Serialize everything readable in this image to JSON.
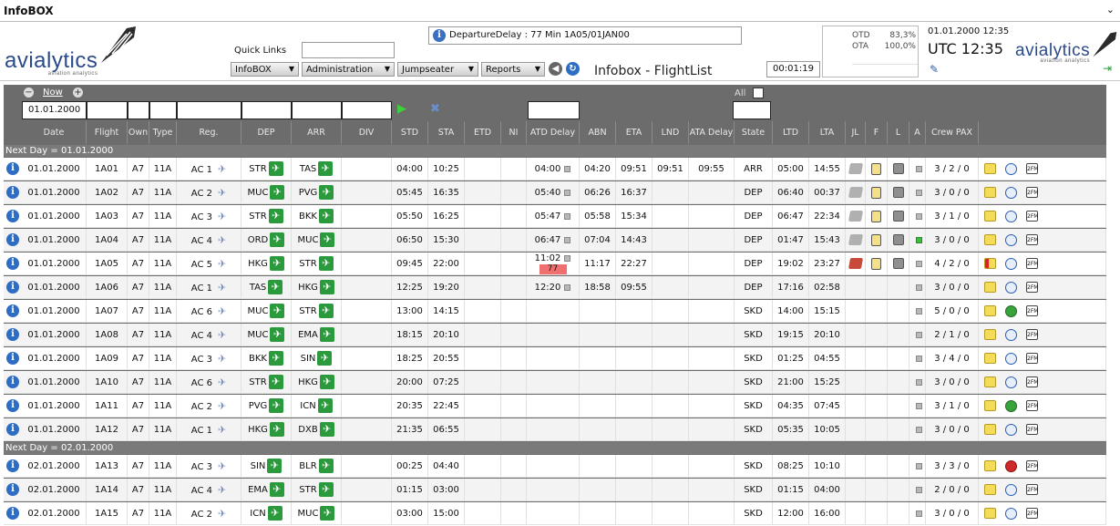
{
  "titlebar": {
    "title": "InfoBOX",
    "chevron": "⌄"
  },
  "header": {
    "logo": "avialytics",
    "logo_sub": "aviation analytics",
    "quick_links_label": "Quick Links",
    "menus": [
      "InfoBOX",
      "Administration",
      "Jumpseater",
      "Reports"
    ],
    "message": "DepartureDelay : 77 Min 1A05/01JAN00",
    "app_title": "Infobox - FlightList",
    "timer": "00:01:19",
    "kpi": [
      {
        "label": "OTD",
        "value": "83,3%"
      },
      {
        "label": "OTA",
        "value": "100,0%"
      }
    ],
    "date_time": "01.01.2000 12:35",
    "utc": "UTC 12:35"
  },
  "controls": {
    "now_label": "Now",
    "date_value": "01.01.2000",
    "all_label": "All"
  },
  "columns": [
    "Date",
    "Flight",
    "Own",
    "Type",
    "Reg.",
    "DEP",
    "ARR",
    "DIV",
    "STD",
    "STA",
    "ETD",
    "NI",
    "ATD Delay",
    "ABN",
    "ETA",
    "LND",
    "ATA Delay",
    "State",
    "LTD",
    "LTA",
    "JL",
    "F",
    "L",
    "A",
    "Crew PAX"
  ],
  "separators": [
    "Next Day = 01.01.2000",
    "Next Day = 02.01.2000"
  ],
  "rows": [
    {
      "date": "01.01.2000",
      "flight": "1A01",
      "own": "A7",
      "type": "11A",
      "reg": "AC 1",
      "dep": "STR",
      "arr": "TAS",
      "std": "04:00",
      "sta": "10:25",
      "atd": "04:00",
      "abn": "04:20",
      "eta": "09:51",
      "lnd": "09:51",
      "ata": "09:55",
      "state": "ARR",
      "ltd": "05:00",
      "lta": "14:55",
      "crew": "3 / 2 / 0",
      "icons": true,
      "a_green": false,
      "book_red": false,
      "clock": "blue"
    },
    {
      "date": "01.01.2000",
      "flight": "1A02",
      "own": "A7",
      "type": "11A",
      "reg": "AC 2",
      "dep": "MUC",
      "arr": "PVG",
      "std": "05:45",
      "sta": "16:35",
      "atd": "05:40",
      "abn": "06:26",
      "eta": "16:37",
      "lnd": "",
      "ata": "",
      "state": "DEP",
      "ltd": "06:40",
      "lta": "00:37",
      "crew": "3 / 0 / 0",
      "icons": true,
      "a_green": false,
      "book_red": false,
      "clock": "blue"
    },
    {
      "date": "01.01.2000",
      "flight": "1A03",
      "own": "A7",
      "type": "11A",
      "reg": "AC 3",
      "dep": "STR",
      "arr": "BKK",
      "std": "05:50",
      "sta": "16:25",
      "atd": "05:47",
      "abn": "05:58",
      "eta": "15:34",
      "lnd": "",
      "ata": "",
      "state": "DEP",
      "ltd": "06:47",
      "lta": "22:34",
      "crew": "3 / 1 / 0",
      "icons": true,
      "a_green": false,
      "book_red": false,
      "clock": "blue"
    },
    {
      "date": "01.01.2000",
      "flight": "1A04",
      "own": "A7",
      "type": "11A",
      "reg": "AC 4",
      "dep": "ORD",
      "arr": "MUC",
      "std": "06:50",
      "sta": "15:30",
      "atd": "06:47",
      "abn": "07:04",
      "eta": "14:43",
      "lnd": "",
      "ata": "",
      "state": "DEP",
      "ltd": "01:47",
      "lta": "15:43",
      "crew": "3 / 0 / 0",
      "icons": true,
      "a_green": true,
      "book_red": false,
      "clock": "blue"
    },
    {
      "date": "01.01.2000",
      "flight": "1A05",
      "own": "A7",
      "type": "11A",
      "reg": "AC 5",
      "dep": "HKG",
      "arr": "STR",
      "std": "09:45",
      "sta": "22:00",
      "atd": "11:02",
      "delay": "77",
      "abn": "11:17",
      "eta": "22:27",
      "lnd": "",
      "ata": "",
      "state": "DEP",
      "ltd": "19:02",
      "lta": "23:27",
      "crew": "4 / 2 / 0",
      "icons": true,
      "a_green": false,
      "book_red": true,
      "clock": "blue"
    },
    {
      "date": "01.01.2000",
      "flight": "1A06",
      "own": "A7",
      "type": "11A",
      "reg": "AC 1",
      "dep": "TAS",
      "arr": "HKG",
      "std": "12:25",
      "sta": "19:20",
      "atd": "12:20",
      "abn": "18:58",
      "eta": "09:55",
      "lnd": "",
      "ata": "",
      "state": "DEP",
      "ltd": "17:16",
      "lta": "02:58",
      "crew": "3 / 0 / 0",
      "icons": false,
      "a_green": false,
      "book_red": false,
      "clock": "blue"
    },
    {
      "date": "01.01.2000",
      "flight": "1A07",
      "own": "A7",
      "type": "11A",
      "reg": "AC 6",
      "dep": "MUC",
      "arr": "STR",
      "std": "13:00",
      "sta": "14:15",
      "atd": "",
      "abn": "",
      "eta": "",
      "lnd": "",
      "ata": "",
      "state": "SKD",
      "ltd": "14:00",
      "lta": "15:15",
      "crew": "5 / 0 / 0",
      "icons": false,
      "a_green": false,
      "book_red": false,
      "clock": "gr"
    },
    {
      "date": "01.01.2000",
      "flight": "1A08",
      "own": "A7",
      "type": "11A",
      "reg": "AC 4",
      "dep": "MUC",
      "arr": "EMA",
      "std": "18:15",
      "sta": "20:10",
      "atd": "",
      "abn": "",
      "eta": "",
      "lnd": "",
      "ata": "",
      "state": "SKD",
      "ltd": "19:15",
      "lta": "20:10",
      "crew": "2 / 1 / 0",
      "icons": false,
      "a_green": false,
      "book_red": false,
      "clock": "blue"
    },
    {
      "date": "01.01.2000",
      "flight": "1A09",
      "own": "A7",
      "type": "11A",
      "reg": "AC 3",
      "dep": "BKK",
      "arr": "SIN",
      "std": "18:25",
      "sta": "20:55",
      "atd": "",
      "abn": "",
      "eta": "",
      "lnd": "",
      "ata": "",
      "state": "SKD",
      "ltd": "01:25",
      "lta": "04:55",
      "crew": "3 / 4 / 0",
      "icons": false,
      "a_green": false,
      "book_red": false,
      "clock": "blue"
    },
    {
      "date": "01.01.2000",
      "flight": "1A10",
      "own": "A7",
      "type": "11A",
      "reg": "AC 6",
      "dep": "STR",
      "arr": "HKG",
      "std": "20:00",
      "sta": "07:25",
      "atd": "",
      "abn": "",
      "eta": "",
      "lnd": "",
      "ata": "",
      "state": "SKD",
      "ltd": "21:00",
      "lta": "15:25",
      "crew": "3 / 0 / 0",
      "icons": false,
      "a_green": false,
      "book_red": false,
      "clock": "blue"
    },
    {
      "date": "01.01.2000",
      "flight": "1A11",
      "own": "A7",
      "type": "11A",
      "reg": "AC 2",
      "dep": "PVG",
      "arr": "ICN",
      "std": "20:35",
      "sta": "22:45",
      "atd": "",
      "abn": "",
      "eta": "",
      "lnd": "",
      "ata": "",
      "state": "SKD",
      "ltd": "04:35",
      "lta": "07:45",
      "crew": "3 / 1 / 0",
      "icons": false,
      "a_green": false,
      "book_red": false,
      "clock": "g"
    },
    {
      "date": "01.01.2000",
      "flight": "1A12",
      "own": "A7",
      "type": "11A",
      "reg": "AC 1",
      "dep": "HKG",
      "arr": "DXB",
      "std": "21:35",
      "sta": "06:55",
      "atd": "",
      "abn": "",
      "eta": "",
      "lnd": "",
      "ata": "",
      "state": "SKD",
      "ltd": "05:35",
      "lta": "10:05",
      "crew": "3 / 0 / 0",
      "icons": false,
      "a_green": false,
      "book_red": false,
      "clock": "blue"
    },
    {
      "date": "02.01.2000",
      "flight": "1A13",
      "own": "A7",
      "type": "11A",
      "reg": "AC 3",
      "dep": "SIN",
      "arr": "BLR",
      "std": "00:25",
      "sta": "04:40",
      "atd": "",
      "abn": "",
      "eta": "",
      "lnd": "",
      "ata": "",
      "state": "SKD",
      "ltd": "08:25",
      "lta": "10:10",
      "crew": "3 / 3 / 0",
      "icons": false,
      "a_green": false,
      "book_red": false,
      "clock": "r"
    },
    {
      "date": "02.01.2000",
      "flight": "1A14",
      "own": "A7",
      "type": "11A",
      "reg": "AC 4",
      "dep": "EMA",
      "arr": "STR",
      "std": "01:15",
      "sta": "03:00",
      "atd": "",
      "abn": "",
      "eta": "",
      "lnd": "",
      "ata": "",
      "state": "SKD",
      "ltd": "01:15",
      "lta": "04:00",
      "crew": "2 / 0 / 0",
      "icons": false,
      "a_green": false,
      "book_red": false,
      "clock": "blue"
    },
    {
      "date": "02.01.2000",
      "flight": "1A15",
      "own": "A7",
      "type": "11A",
      "reg": "AC 2",
      "dep": "ICN",
      "arr": "MUC",
      "std": "03:00",
      "sta": "15:00",
      "atd": "",
      "abn": "",
      "eta": "",
      "lnd": "",
      "ata": "",
      "state": "SKD",
      "ltd": "12:00",
      "lta": "16:00",
      "crew": "3 / 0 / 0",
      "icons": false,
      "a_green": false,
      "book_red": false,
      "clock": "blue"
    }
  ]
}
